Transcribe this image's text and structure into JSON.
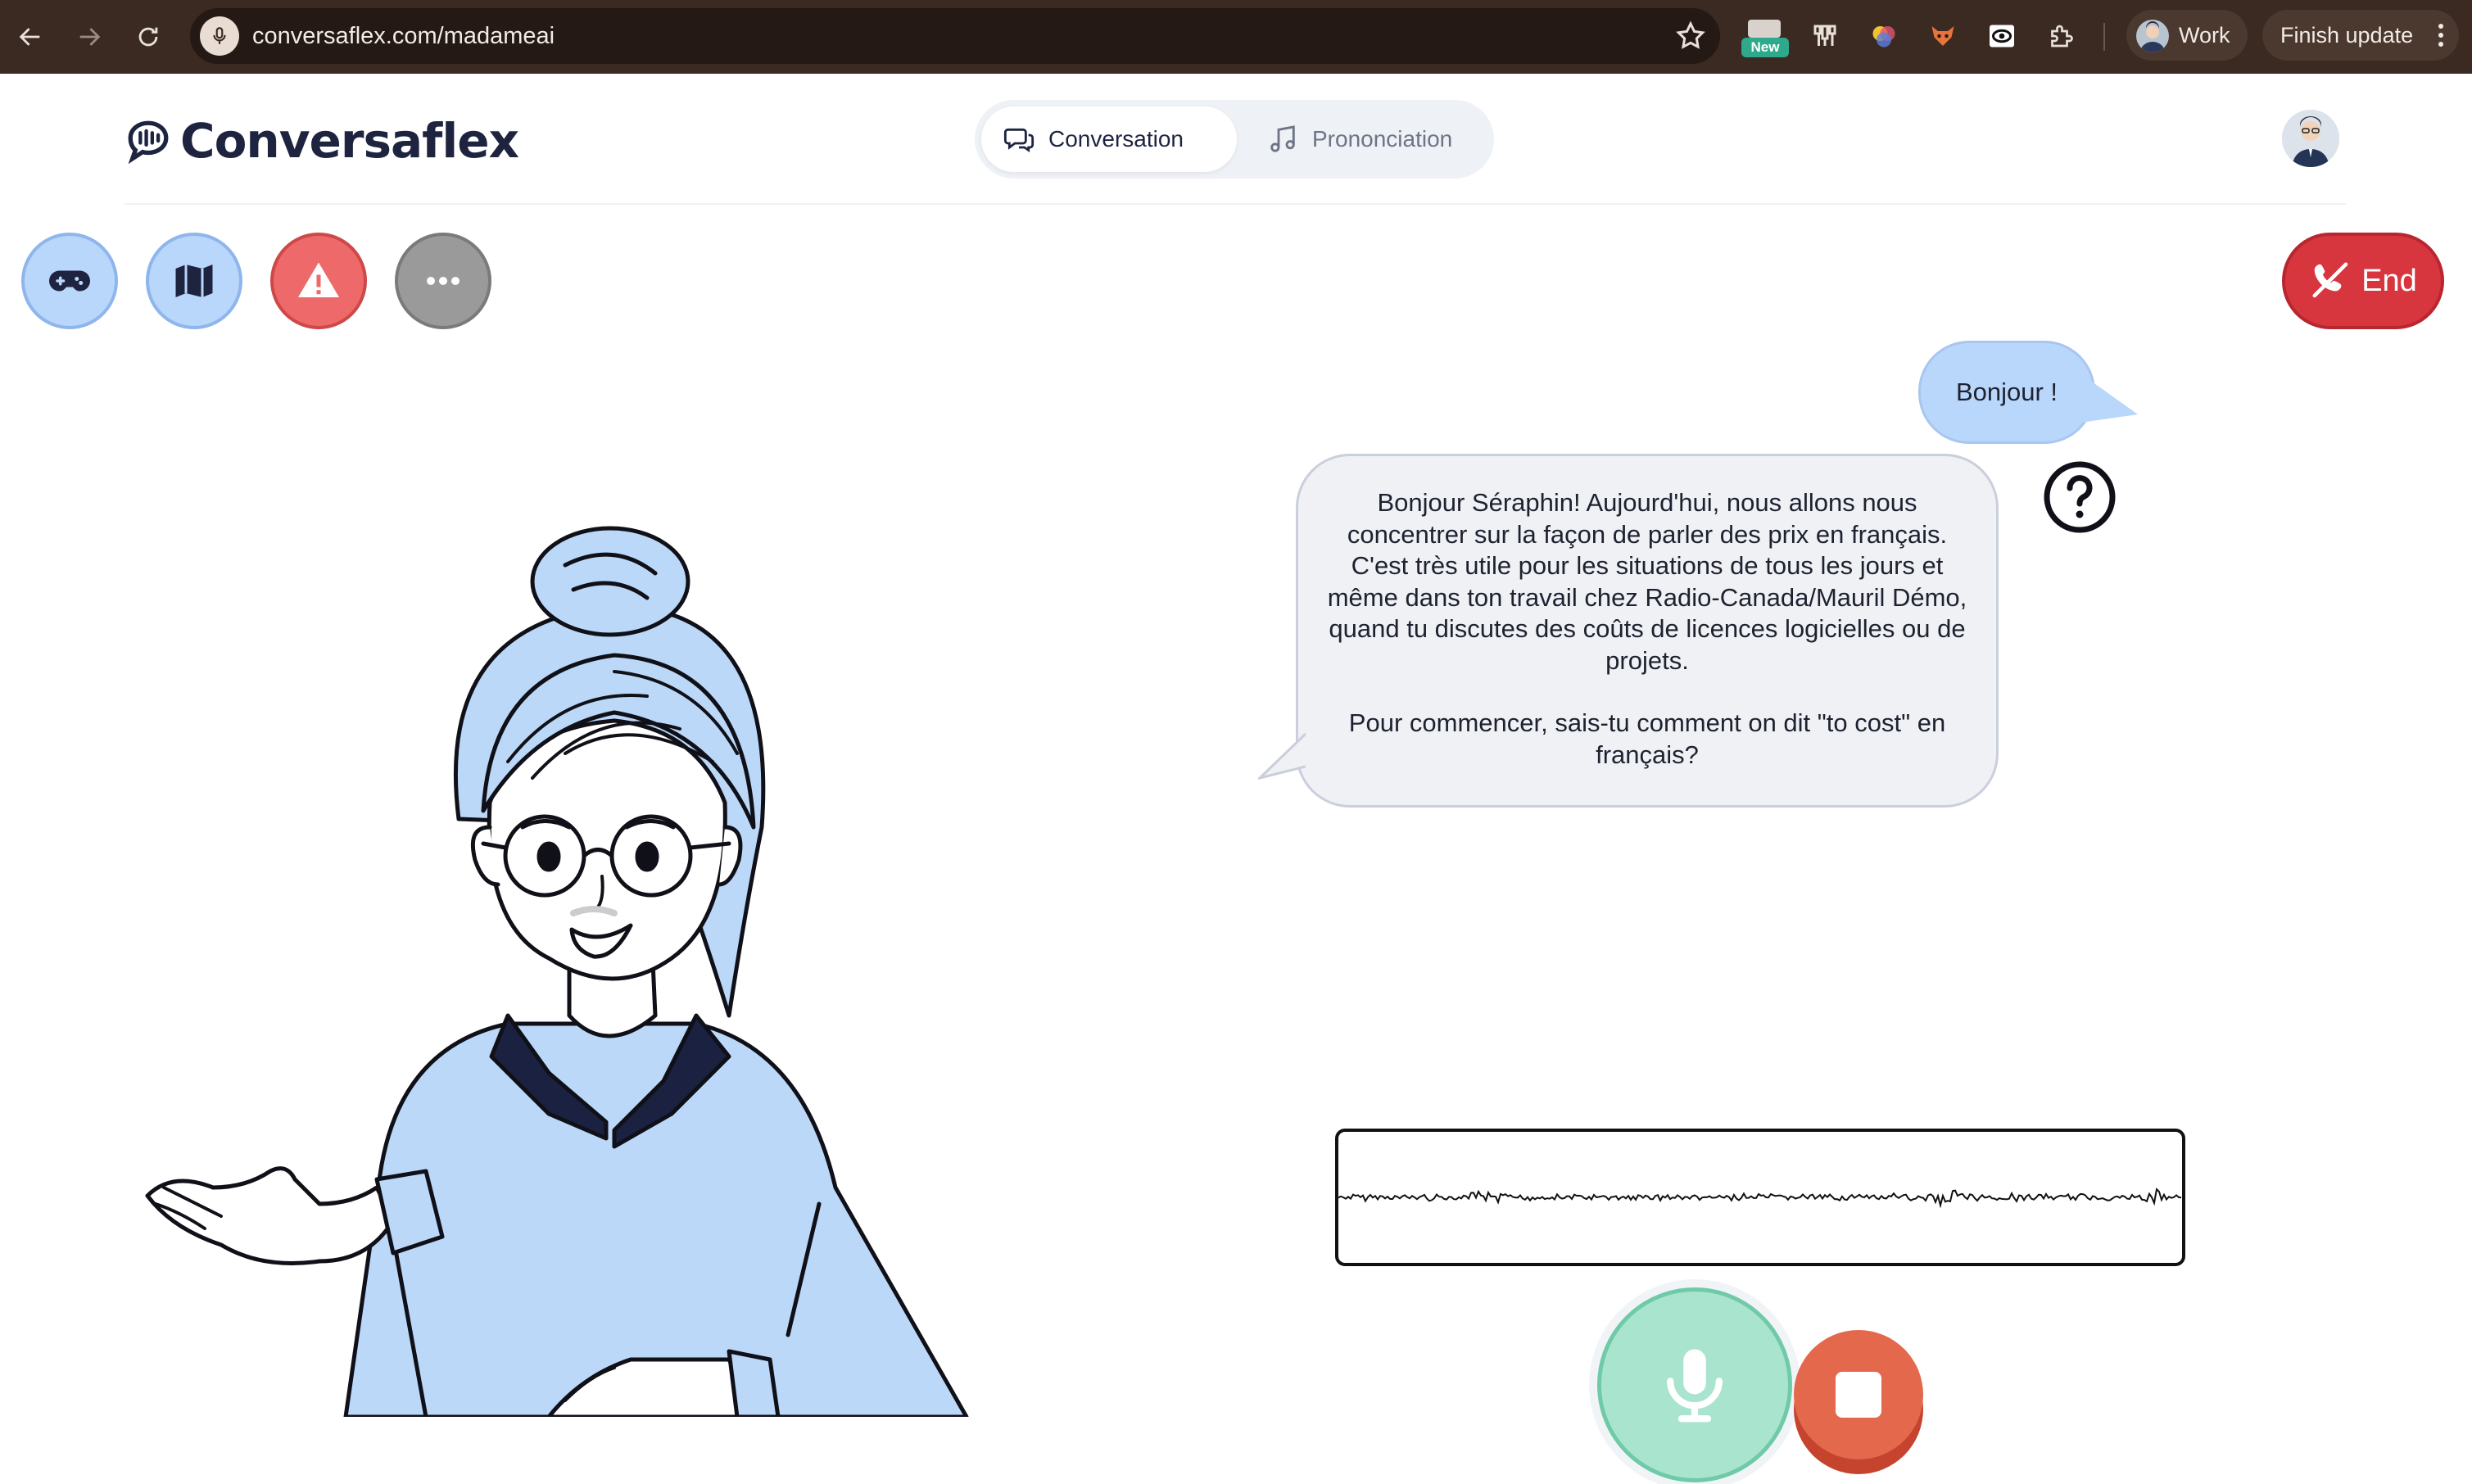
{
  "browser": {
    "url": "conversaflex.com/madameai",
    "extension_badge": "New",
    "profile_label": "Work",
    "update_label": "Finish update",
    "icons": [
      "back-icon",
      "forward-icon",
      "reload-icon",
      "microphone-icon",
      "star-icon",
      "extensions-puzzle-icon",
      "kebab-menu-icon"
    ]
  },
  "app": {
    "brand": "Conversaflex",
    "tabs": [
      {
        "label": "Conversation",
        "icon": "chat-bubbles-icon",
        "active": true
      },
      {
        "label": "Prononciation",
        "icon": "music-note-icon",
        "active": false
      }
    ],
    "actions": [
      {
        "name": "game",
        "icon": "gamepad-icon"
      },
      {
        "name": "map",
        "icon": "map-icon"
      },
      {
        "name": "warning",
        "icon": "warning-triangle-icon"
      },
      {
        "name": "more",
        "icon": "ellipsis-icon"
      }
    ],
    "end_label": "End"
  },
  "chat": {
    "user_message": "Bonjour !",
    "assistant_paragraph_1": "Bonjour Séraphin! Aujourd'hui, nous allons nous concentrer sur la façon de parler des prix en français. C'est très utile pour les situations de tous les jours et même dans ton travail chez Radio-Canada/Mauril Démo, quand tu discutes des coûts de licences logicielles ou de projets.",
    "assistant_paragraph_2": "Pour commencer, sais-tu comment on dit \"to cost\" en français?"
  },
  "colors": {
    "accent_blue": "#b9d6fb",
    "danger_red": "#d8363f",
    "mic_green": "#a9e4cf",
    "stop_orange": "#e3684c",
    "brand_navy": "#1e2440",
    "chrome_brown": "#3b2a22"
  }
}
